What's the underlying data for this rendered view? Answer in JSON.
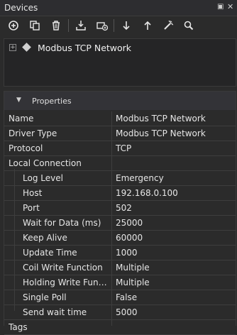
{
  "window": {
    "title": "Devices"
  },
  "toolbar": {
    "buttons": [
      {
        "icon": "add-icon"
      },
      {
        "icon": "copy-icon"
      },
      {
        "icon": "delete-icon"
      },
      {
        "icon": "import-icon"
      },
      {
        "icon": "add-device-icon"
      },
      {
        "icon": "move-down-icon"
      },
      {
        "icon": "move-up-icon"
      },
      {
        "icon": "scan-icon"
      },
      {
        "icon": "search-icon"
      }
    ]
  },
  "tree": {
    "items": [
      {
        "label": "Modbus TCP Network",
        "expander": "+"
      }
    ]
  },
  "properties": {
    "title": "Properties",
    "rows": [
      {
        "name": "Name",
        "value": "Modbus TCP Network"
      },
      {
        "name": "Driver Type",
        "value": "Modbus TCP Network"
      },
      {
        "name": "Protocol",
        "value": "TCP"
      },
      {
        "name": "Local Connection",
        "value": ""
      },
      {
        "name": "Log Level",
        "value": "Emergency"
      },
      {
        "name": "Host",
        "value": "192.168.0.100"
      },
      {
        "name": "Port",
        "value": "502"
      },
      {
        "name": "Wait for Data (ms)",
        "value": "25000"
      },
      {
        "name": "Keep Alive",
        "value": "60000"
      },
      {
        "name": "Update Time",
        "value": "1000"
      },
      {
        "name": "Coil Write Function",
        "value": "Multiple"
      },
      {
        "name": "Holding Write Functi...",
        "value": "Multiple"
      },
      {
        "name": "Single Poll",
        "value": "False"
      },
      {
        "name": "Send wait time",
        "value": "5000"
      },
      {
        "name": "Tags",
        "value": ""
      }
    ]
  }
}
